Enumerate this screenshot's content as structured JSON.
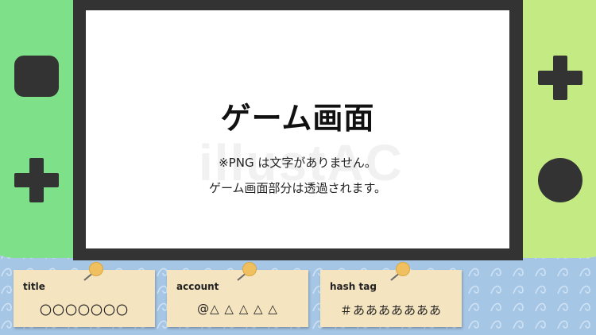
{
  "screen": {
    "title": "ゲーム画面",
    "note_line1": "※PNG は文字がありません。",
    "note_line2": "ゲーム画面部分は透過されます。"
  },
  "watermark": "illustAC",
  "cards": [
    {
      "label": "title",
      "value": "〇〇〇〇〇〇〇"
    },
    {
      "label": "account",
      "value": "@△ △ △ △ △"
    },
    {
      "label": "hash tag",
      "value": "＃あああああああ"
    }
  ],
  "colors": {
    "background": "#a6c6e6",
    "joycon_left": "#7fe08a",
    "joycon_right": "#c4ea84",
    "frame": "#333333",
    "screen": "#ffffff",
    "card": "#f5e4c0",
    "pin": "#f0c060"
  },
  "icons": {
    "left_top": "square-button-icon",
    "left_bottom": "dpad-icon",
    "right_top": "dpad-icon",
    "right_bottom": "circle-button-icon"
  }
}
